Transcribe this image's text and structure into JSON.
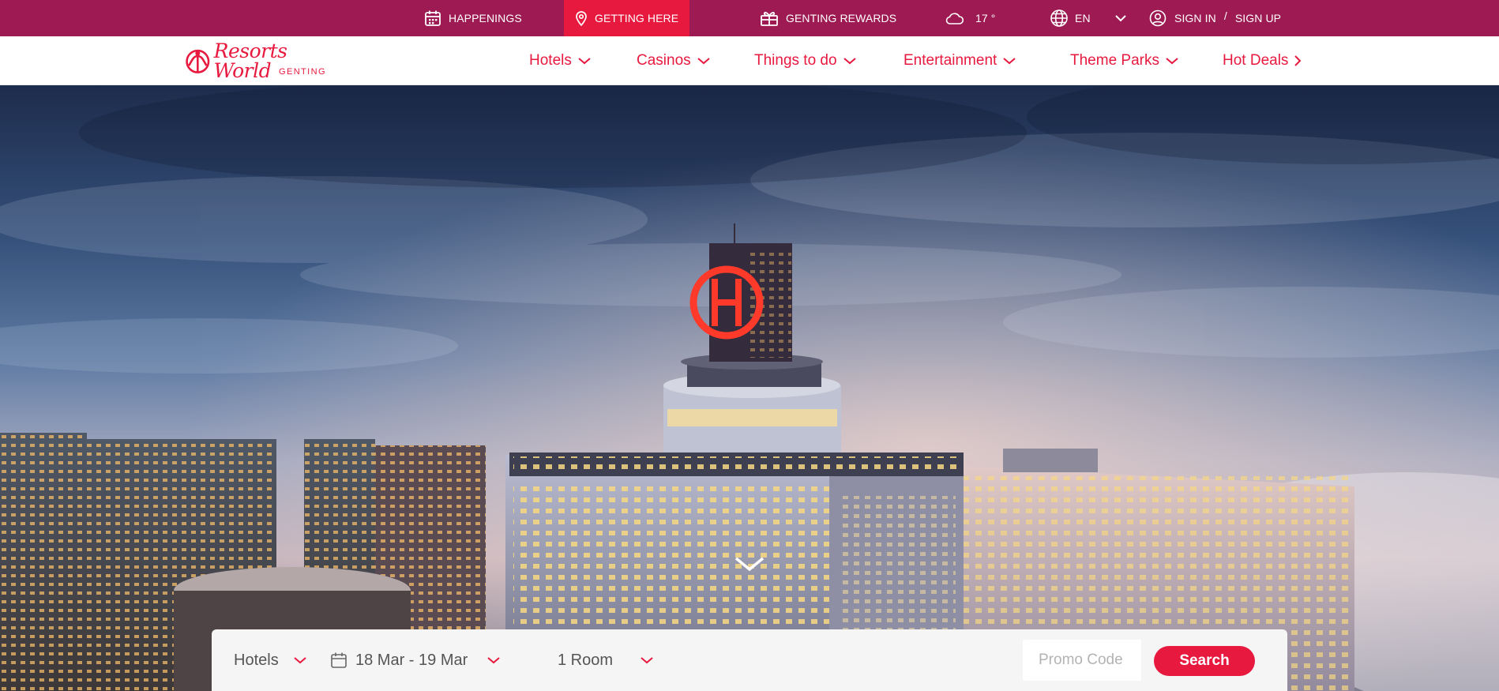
{
  "topbar": {
    "happenings": "HAPPENINGS",
    "getting_here": "GETTING HERE",
    "rewards": "GENTING REWARDS",
    "temperature": "17 °",
    "language": "EN",
    "sign_in": "SIGN IN",
    "separator": "/",
    "sign_up": "SIGN UP"
  },
  "logo": {
    "script": "Resorts World",
    "sub": "GENTING"
  },
  "nav": {
    "items": [
      "Hotels",
      "Casinos",
      "Things to do",
      "Entertainment",
      "Theme Parks",
      "Hot Deals"
    ]
  },
  "booking": {
    "category": "Hotels",
    "dates": "18 Mar - 19 Mar",
    "rooms": "1 Room",
    "promo_placeholder": "Promo Code",
    "search_label": "Search"
  },
  "colors": {
    "topbar": "#9d1a52",
    "accent": "#e8193f",
    "white": "#ffffff"
  },
  "icons": [
    "calendar-icon",
    "location-pin-icon",
    "gift-icon",
    "cloud-icon",
    "globe-icon",
    "chevron-down-icon",
    "user-icon",
    "chevron-right-icon"
  ]
}
